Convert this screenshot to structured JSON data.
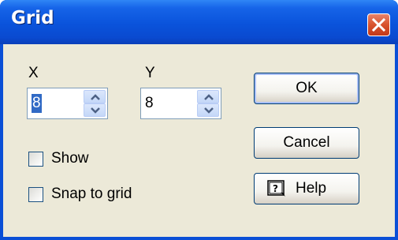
{
  "window": {
    "title": "Grid"
  },
  "fields": {
    "x_label": "X",
    "x_value": "8",
    "y_label": "Y",
    "y_value": "8"
  },
  "checkboxes": {
    "show_label": "Show",
    "show_checked": false,
    "snap_label": "Snap to grid",
    "snap_checked": false
  },
  "buttons": {
    "ok_label": "OK",
    "cancel_label": "Cancel",
    "help_label": "Help"
  },
  "icons": {
    "close": "close-icon",
    "help": "help-book-icon",
    "spin_up": "arrow-up-icon",
    "spin_down": "arrow-down-icon"
  },
  "colors": {
    "titlebar": "#0a53db",
    "close_button": "#d8532d",
    "dialog_background": "#ece9d8",
    "selection": "#316ac5"
  }
}
